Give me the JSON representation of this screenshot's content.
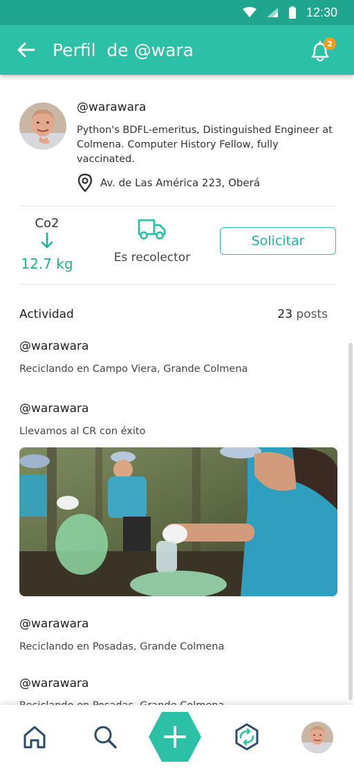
{
  "status_bar": {
    "time": "12:30"
  },
  "app_bar": {
    "title": "Perfil  de @wara",
    "notification_count": "2"
  },
  "profile": {
    "handle": "@warawara",
    "bio": "Python's BDFL-emeritus, Distinguished Engineer at Colmena. Computer History Fellow, fully vaccinated.",
    "location": "Av. de Las América 223, Oberá"
  },
  "stats": {
    "co2_label": "Co2",
    "co2_value": "12.7 kg",
    "recolector_label": "Es recolector",
    "solicitar_label": "Solicitar"
  },
  "activity": {
    "title": "Actividad",
    "posts_count": "23",
    "posts_label": "posts",
    "posts": [
      {
        "user": "@warawara",
        "text": "Reciclando en Campo Viera, Grande Colmena"
      },
      {
        "user": "@warawara",
        "text": "Llevamos al CR con éxito"
      },
      {
        "user": "@warawara",
        "text": "Reciclando en Posadas, Grande Colmena"
      },
      {
        "user": "@warawara",
        "text": "Reciclando en Posadas, Grande Colmena"
      }
    ]
  },
  "colors": {
    "primary": "#2cc1a6",
    "status_bar": "#20a58f",
    "accent_value": "#1bb495",
    "badge": "#f59b1c"
  },
  "nav": {
    "icons": [
      "home-icon",
      "search-icon",
      "add-icon",
      "exchange-icon",
      "profile-avatar"
    ]
  }
}
